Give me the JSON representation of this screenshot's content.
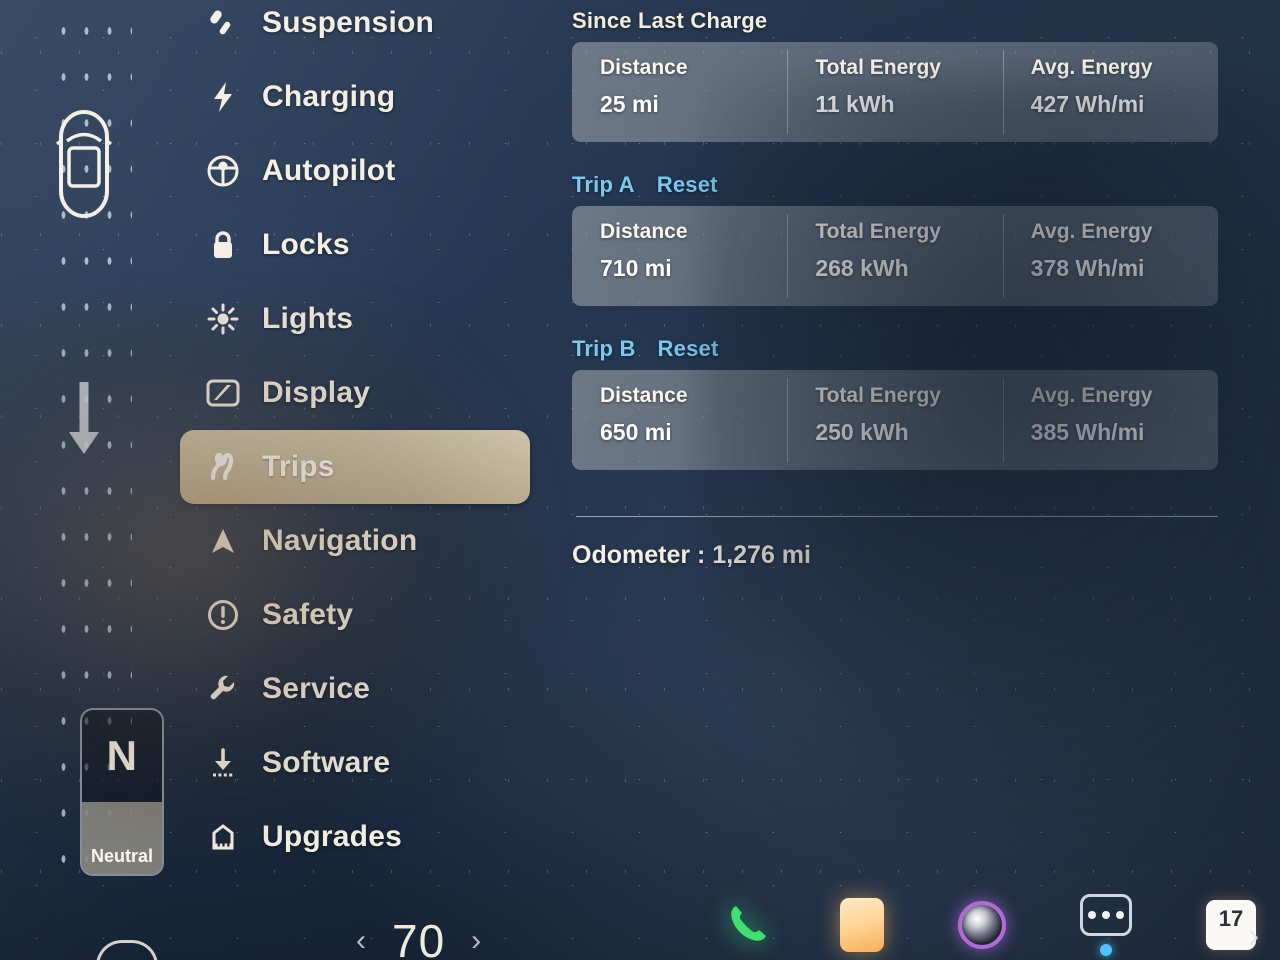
{
  "app": {
    "screen_title": "Trips"
  },
  "vehicle_status": {
    "gear_letter": "N",
    "gear_label": "Neutral",
    "car_icon": "car-top-view-icon",
    "arrow_icon": "arrow-down-icon"
  },
  "sidebar": {
    "items": [
      {
        "label": "Suspension",
        "icon": "suspension-icon",
        "active": false
      },
      {
        "label": "Charging",
        "icon": "lightning-bolt-icon",
        "active": false
      },
      {
        "label": "Autopilot",
        "icon": "steering-wheel-icon",
        "active": false
      },
      {
        "label": "Locks",
        "icon": "lock-icon",
        "active": false
      },
      {
        "label": "Lights",
        "icon": "sun-brightness-icon",
        "active": false
      },
      {
        "label": "Display",
        "icon": "display-screen-icon",
        "active": false
      },
      {
        "label": "Trips",
        "icon": "winding-road-icon",
        "active": true
      },
      {
        "label": "Navigation",
        "icon": "navigation-arrow-icon",
        "active": false
      },
      {
        "label": "Safety",
        "icon": "exclamation-circle-icon",
        "active": false
      },
      {
        "label": "Service",
        "icon": "wrench-icon",
        "active": false
      },
      {
        "label": "Software",
        "icon": "download-arrow-icon",
        "active": false
      },
      {
        "label": "Upgrades",
        "icon": "shopping-bag-icon",
        "active": false
      }
    ]
  },
  "trips": {
    "columns": [
      "Distance",
      "Total Energy",
      "Avg. Energy"
    ],
    "sections": [
      {
        "title": "Since Last Charge",
        "has_reset": false,
        "reset_label": "",
        "values": [
          "25 mi",
          "11 kWh",
          "427 Wh/mi"
        ]
      },
      {
        "title": "Trip A",
        "has_reset": true,
        "reset_label": "Reset",
        "values": [
          "710 mi",
          "268 kWh",
          "378 Wh/mi"
        ]
      },
      {
        "title": "Trip B",
        "has_reset": true,
        "reset_label": "Reset",
        "values": [
          "650 mi",
          "250 kWh",
          "385 Wh/mi"
        ]
      }
    ],
    "odometer_label": "Odometer :",
    "odometer_value": "1,276 mi",
    "odometer_line": "Odometer : 1,276 mi"
  },
  "bottom_bar": {
    "temperature": "70",
    "chevron_left": "‹",
    "chevron_right": "›",
    "icons": [
      {
        "name": "phone-icon"
      },
      {
        "name": "app-tile-icon"
      },
      {
        "name": "camera-lens-icon"
      },
      {
        "name": "more-apps-icon"
      },
      {
        "name": "calendar-icon"
      }
    ],
    "calendar_day": "17"
  },
  "colors": {
    "accent_link": "#79c9ef",
    "active_pill": "#c6baa0",
    "card_bg": "#96a0ac",
    "text_primary": "#f4f0e4",
    "screen_bg": "#17263a"
  }
}
